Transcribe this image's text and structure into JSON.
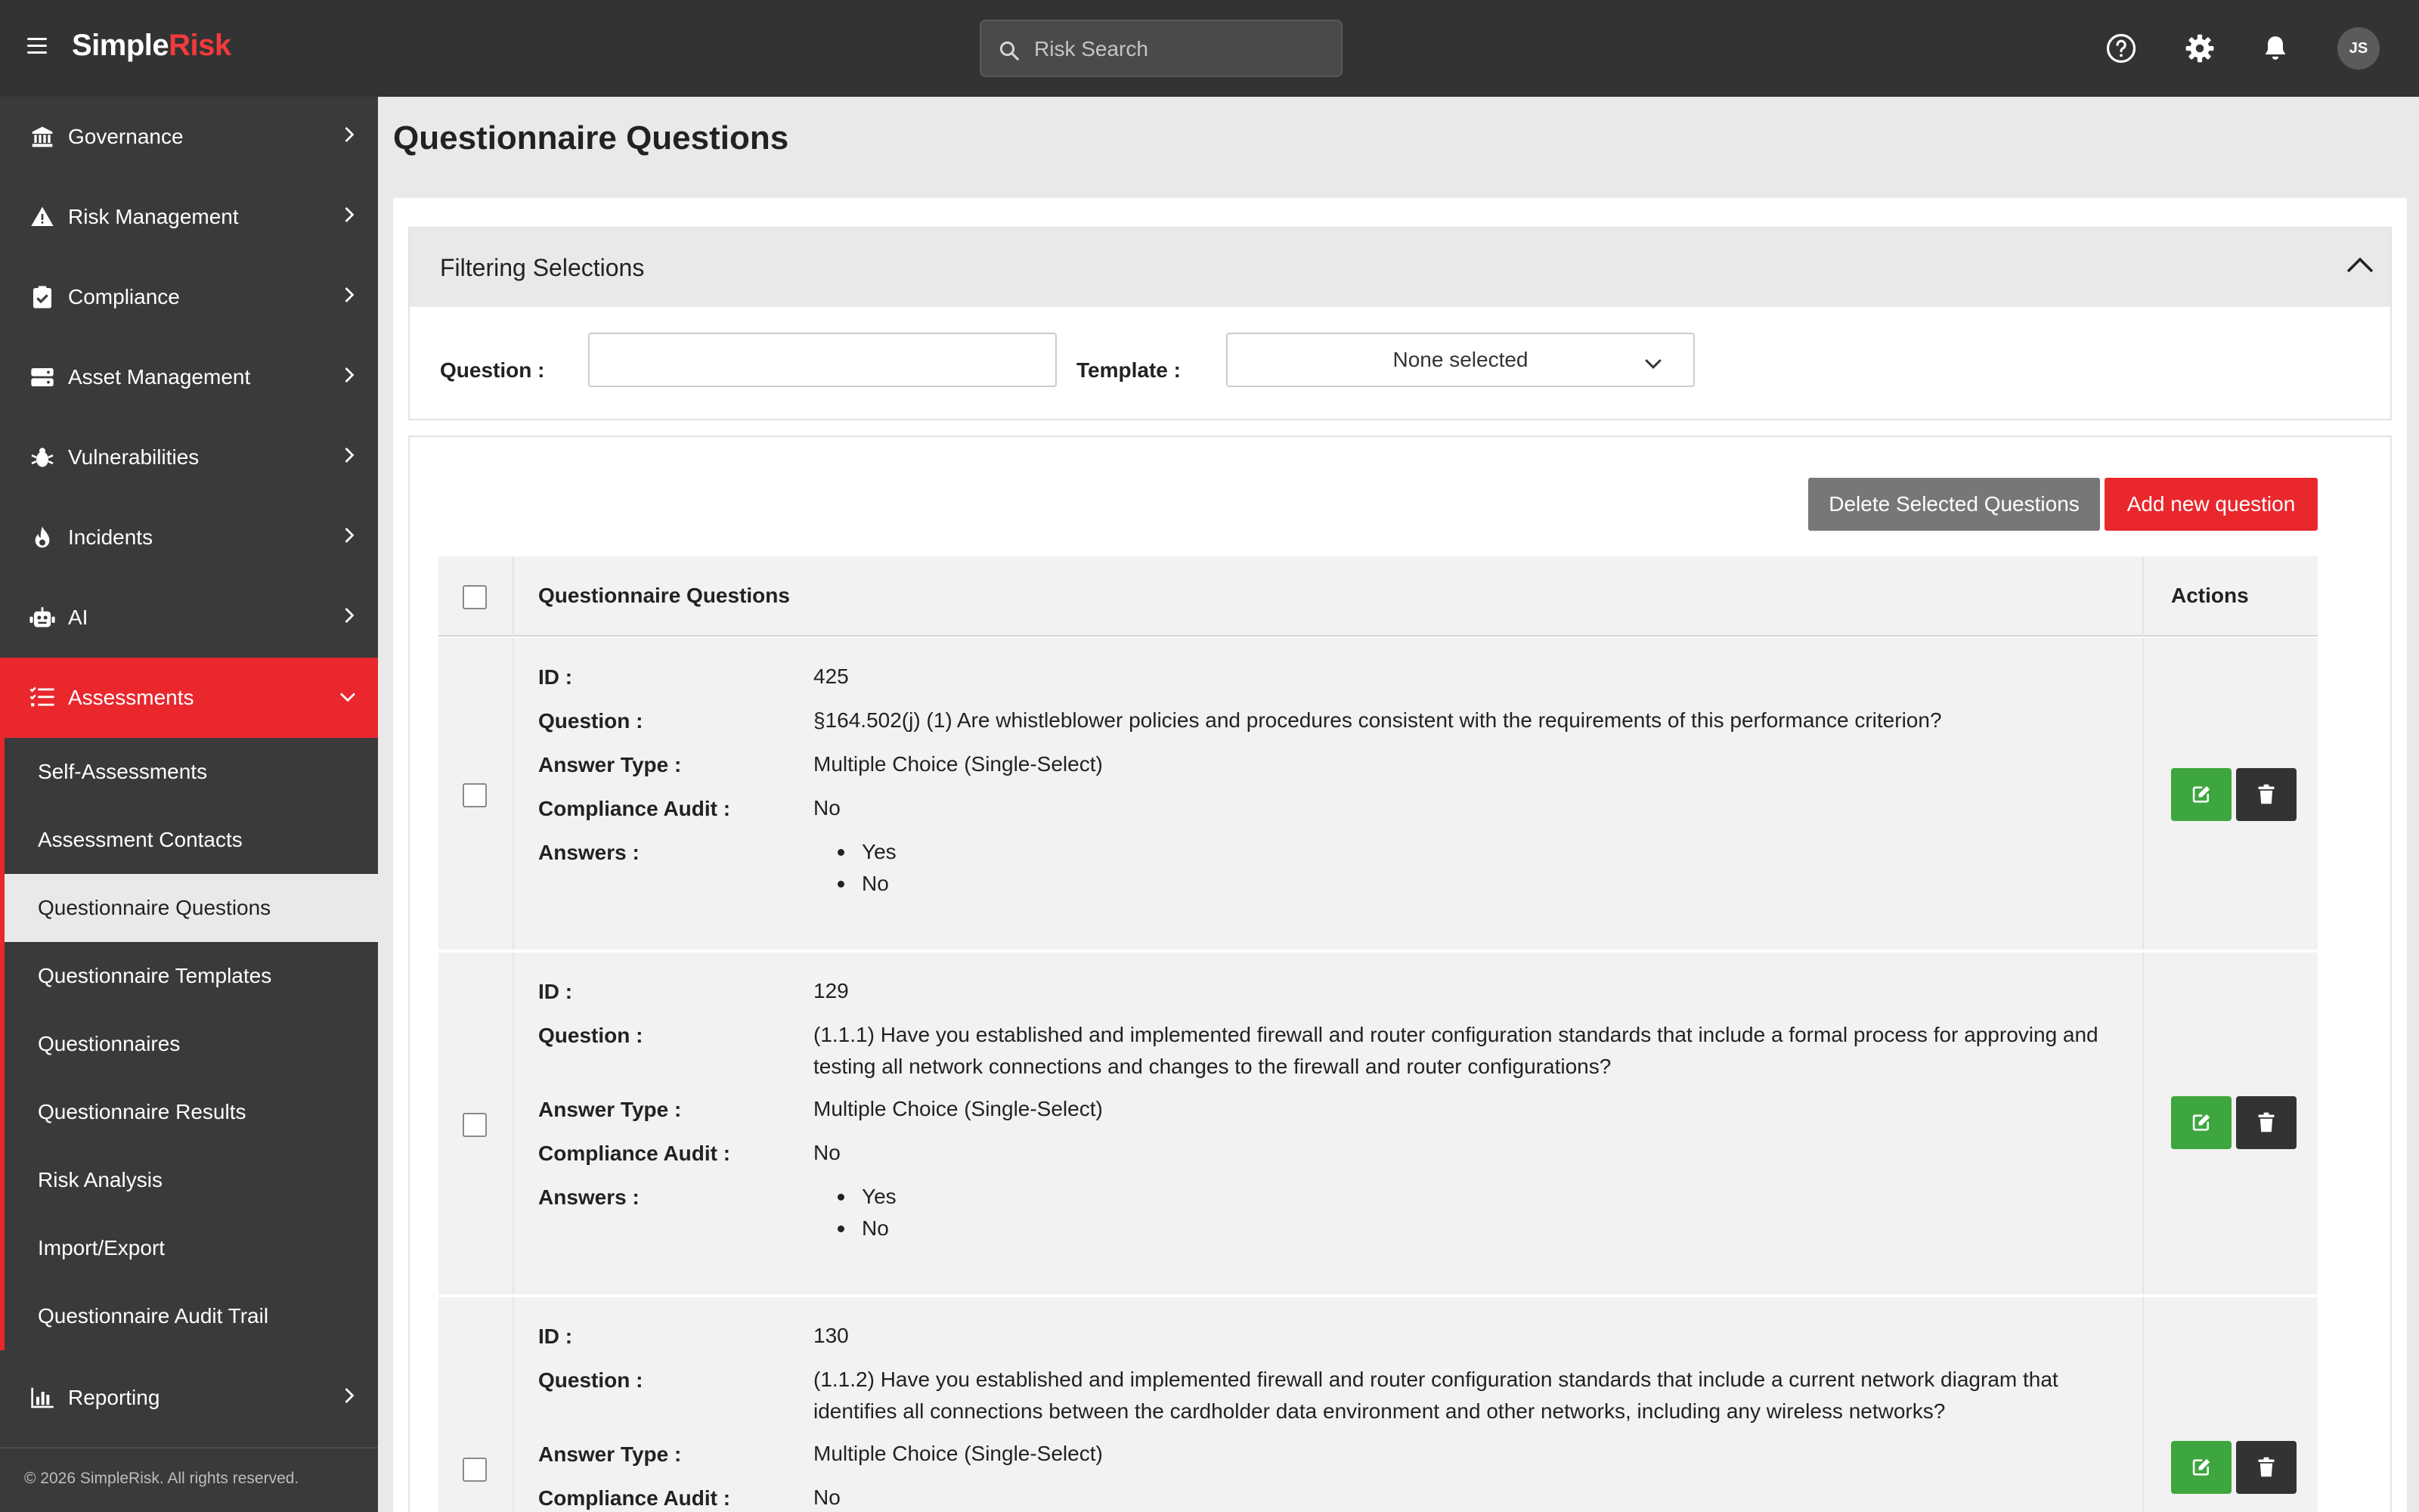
{
  "app": {
    "logo_part1": "Simple",
    "logo_part2": "Risk",
    "brand_color": "#e9272d"
  },
  "search": {
    "placeholder": "Risk Search"
  },
  "user": {
    "initials": "JS"
  },
  "sidebar": {
    "items": [
      {
        "label": "Governance",
        "icon": "bank-icon"
      },
      {
        "label": "Risk Management",
        "icon": "warning-icon"
      },
      {
        "label": "Compliance",
        "icon": "clipboard-check-icon"
      },
      {
        "label": "Asset Management",
        "icon": "server-icon"
      },
      {
        "label": "Vulnerabilities",
        "icon": "bug-icon"
      },
      {
        "label": "Incidents",
        "icon": "fire-icon"
      },
      {
        "label": "AI",
        "icon": "robot-icon"
      },
      {
        "label": "Assessments",
        "icon": "list-check-icon",
        "active": true
      },
      {
        "label": "Reporting",
        "icon": "bar-chart-icon"
      }
    ],
    "assessments_sub": [
      "Self-Assessments",
      "Assessment Contacts",
      "Questionnaire Questions",
      "Questionnaire Templates",
      "Questionnaires",
      "Questionnaire Results",
      "Risk Analysis",
      "Import/Export",
      "Questionnaire Audit Trail"
    ],
    "current_sub": "Questionnaire Questions",
    "footer": "© 2026 SimpleRisk. All rights reserved."
  },
  "page": {
    "title": "Questionnaire Questions"
  },
  "filter": {
    "title": "Filtering Selections",
    "question_label": "Question :",
    "question_value": "",
    "template_label": "Template :",
    "template_value": "None selected"
  },
  "toolbar": {
    "delete_label": "Delete Selected Questions",
    "add_label": "Add new question"
  },
  "table": {
    "header": "Questionnaire Questions",
    "actions_header": "Actions",
    "labels": {
      "id": "ID :",
      "question": "Question :",
      "answer_type": "Answer Type :",
      "compliance_audit": "Compliance Audit :",
      "answers": "Answers :"
    },
    "rows": [
      {
        "id": "425",
        "question": "§164.502(j) (1) Are whistleblower policies and procedures consistent with the requirements of this performance criterion?",
        "answer_type": "Multiple Choice (Single-Select)",
        "compliance_audit": "No",
        "answers": [
          "Yes",
          "No"
        ]
      },
      {
        "id": "129",
        "question": "(1.1.1) Have you established and implemented firewall and router configuration standards that include a formal process for approving and testing all network connections and changes to the firewall and router configurations?",
        "answer_type": "Multiple Choice (Single-Select)",
        "compliance_audit": "No",
        "answers": [
          "Yes",
          "No"
        ]
      },
      {
        "id": "130",
        "question": "(1.1.2) Have you established and implemented firewall and router configuration standards that include a current network diagram that identifies all connections between the cardholder data environment and other networks, including any wireless networks?",
        "answer_type": "Multiple Choice (Single-Select)",
        "compliance_audit": "No",
        "answers": []
      }
    ]
  }
}
